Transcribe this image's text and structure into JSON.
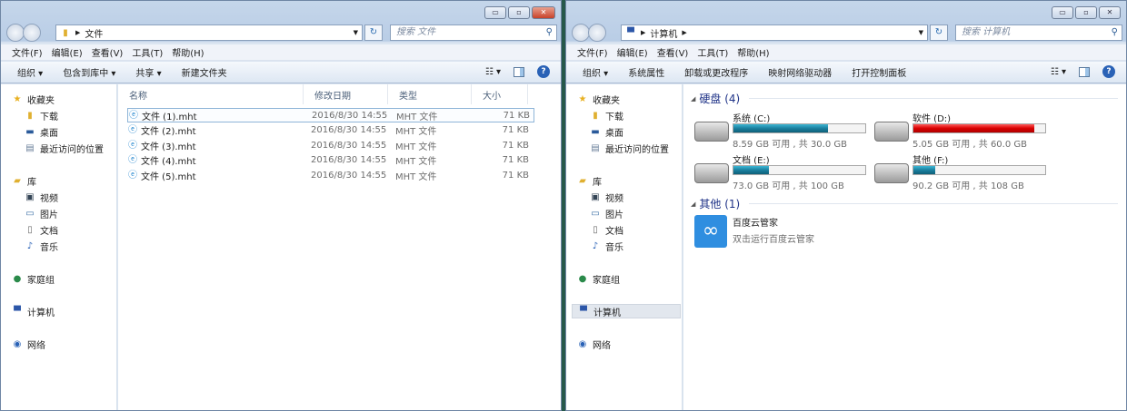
{
  "left": {
    "path": "文件",
    "search_placeholder": "搜索 文件",
    "menu": [
      "文件(F)",
      "编辑(E)",
      "查看(V)",
      "工具(T)",
      "帮助(H)"
    ],
    "toolbar": [
      "组织 ▾",
      "包含到库中 ▾",
      "共享 ▾",
      "新建文件夹"
    ],
    "columns": [
      "名称",
      "修改日期",
      "类型",
      "大小"
    ],
    "files": [
      {
        "name": "文件 (1).mht",
        "date": "2016/8/30 14:55",
        "type": "MHT 文件",
        "size": "71 KB"
      },
      {
        "name": "文件 (2).mht",
        "date": "2016/8/30 14:55",
        "type": "MHT 文件",
        "size": "71 KB"
      },
      {
        "name": "文件 (3).mht",
        "date": "2016/8/30 14:55",
        "type": "MHT 文件",
        "size": "71 KB"
      },
      {
        "name": "文件 (4).mht",
        "date": "2016/8/30 14:55",
        "type": "MHT 文件",
        "size": "71 KB"
      },
      {
        "name": "文件 (5).mht",
        "date": "2016/8/30 14:55",
        "type": "MHT 文件",
        "size": "71 KB"
      }
    ]
  },
  "right": {
    "path": "计算机",
    "search_placeholder": "搜索 计算机",
    "menu": [
      "文件(F)",
      "编辑(E)",
      "查看(V)",
      "工具(T)",
      "帮助(H)"
    ],
    "toolbar": [
      "组织 ▾",
      "系统属性",
      "卸载或更改程序",
      "映射网络驱动器",
      "打开控制面板"
    ],
    "group_drives": "硬盘 (4)",
    "group_other": "其他 (1)",
    "drives": [
      {
        "name": "系统 (C:)",
        "free": "8.59 GB 可用 , 共 30.0 GB",
        "used_fraction": 0.714
      },
      {
        "name": "软件 (D:)",
        "free": "5.05 GB 可用 , 共 60.0 GB",
        "used_fraction": 0.916
      },
      {
        "name": "文档 (E:)",
        "free": "73.0 GB 可用 , 共 100 GB",
        "used_fraction": 0.27
      },
      {
        "name": "其他 (F:)",
        "free": "90.2 GB 可用 , 共 108 GB",
        "used_fraction": 0.165
      }
    ],
    "app": {
      "name": "百度云管家",
      "desc": "双击运行百度云管家"
    }
  },
  "sidebar": {
    "favorites": "收藏夹",
    "downloads": "下载",
    "desktop": "桌面",
    "recent": "最近访问的位置",
    "libraries": "库",
    "videos": "视频",
    "pictures": "图片",
    "documents": "文档",
    "music": "音乐",
    "homegroup": "家庭组",
    "computer": "计算机",
    "network": "网络"
  }
}
